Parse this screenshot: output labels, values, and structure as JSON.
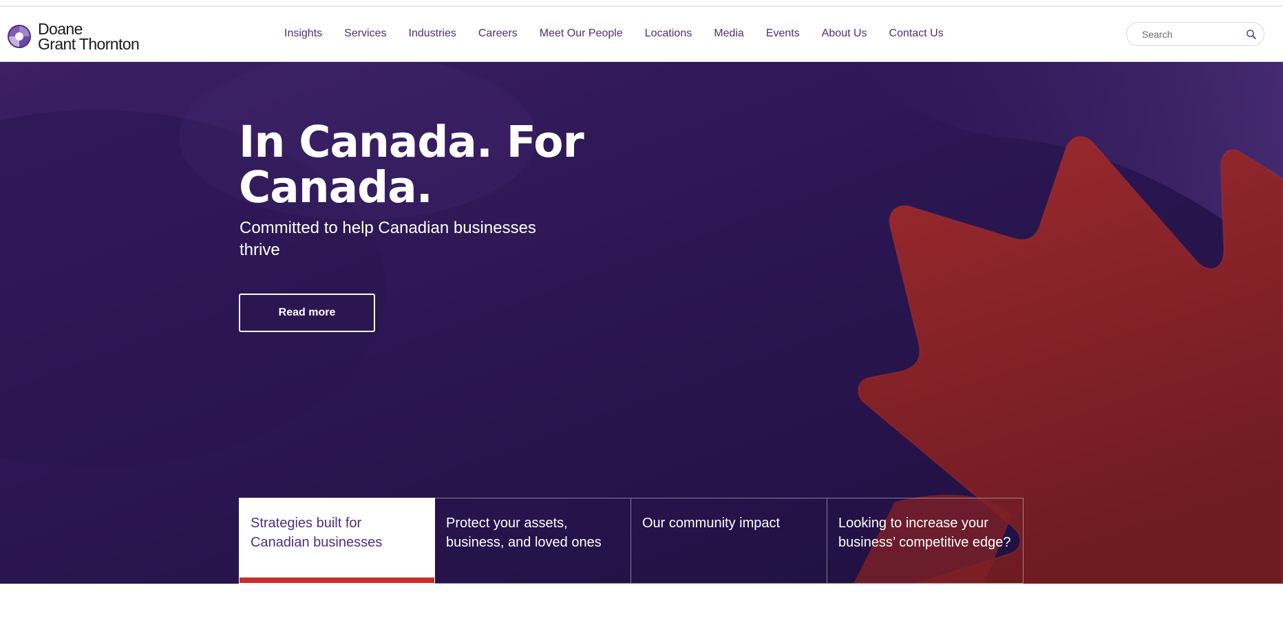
{
  "brand": {
    "line1": "Doane",
    "line2": "Grant Thornton",
    "primary_color": "#4f2d7f",
    "accent_color": "#ce2c2c"
  },
  "nav": {
    "items": [
      {
        "label": "Insights"
      },
      {
        "label": "Services"
      },
      {
        "label": "Industries"
      },
      {
        "label": "Careers"
      },
      {
        "label": "Meet Our People"
      },
      {
        "label": "Locations"
      },
      {
        "label": "Media"
      },
      {
        "label": "Events"
      },
      {
        "label": "About Us"
      },
      {
        "label": "Contact Us"
      }
    ]
  },
  "search": {
    "placeholder": "Search",
    "icon": "search-icon"
  },
  "hero": {
    "title_line1": "In Canada. For",
    "title_line2": "Canada.",
    "subtitle": "Committed to help Canadian businesses thrive",
    "cta_label": "Read more",
    "background_color": "#2b1652",
    "graphic": "maple-leaf-graphic"
  },
  "tabs": [
    {
      "label": "Strategies built for Canadian businesses",
      "active": true
    },
    {
      "label": "Protect your assets, business, and loved ones",
      "active": false
    },
    {
      "label": "Our community impact",
      "active": false
    },
    {
      "label": "Looking to increase your business’ competitive edge?",
      "active": false
    }
  ]
}
